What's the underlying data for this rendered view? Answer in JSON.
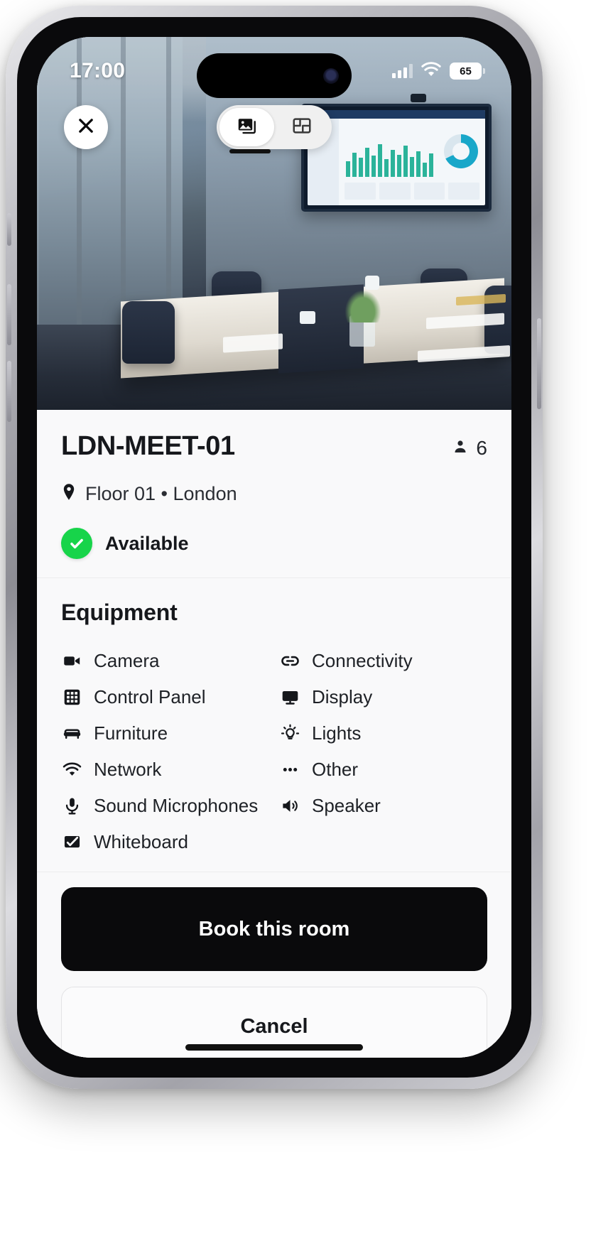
{
  "status_bar": {
    "time": "17:00",
    "battery_percent": "65",
    "signal_icon": "cellular-signal-icon",
    "wifi_icon": "wifi-icon"
  },
  "overlay": {
    "close_label": "×",
    "close_icon": "close-icon",
    "view_toggle": [
      {
        "id": "photo",
        "icon": "photos-icon",
        "active": true
      },
      {
        "id": "floorplan",
        "icon": "floorplan-icon",
        "active": false
      }
    ]
  },
  "room": {
    "name": "LDN-MEET-01",
    "capacity": "6",
    "capacity_icon": "person-icon",
    "location_icon": "map-pin-icon",
    "location": "Floor 01 • London",
    "status_icon": "check-circle-icon",
    "status": "Available",
    "status_color": "#17d44a"
  },
  "equipment": {
    "title": "Equipment",
    "items": [
      {
        "label": "Camera",
        "icon": "video-camera-icon"
      },
      {
        "label": "Connectivity",
        "icon": "link-icon"
      },
      {
        "label": "Control Panel",
        "icon": "grid-keypad-icon"
      },
      {
        "label": "Display",
        "icon": "monitor-icon"
      },
      {
        "label": "Furniture",
        "icon": "sofa-icon"
      },
      {
        "label": "Lights",
        "icon": "lightbulb-icon"
      },
      {
        "label": "Network",
        "icon": "wifi-icon"
      },
      {
        "label": "Other",
        "icon": "ellipsis-icon"
      },
      {
        "label": "Sound Microphones",
        "icon": "microphone-icon"
      },
      {
        "label": "Speaker",
        "icon": "speaker-icon"
      },
      {
        "label": "Whiteboard",
        "icon": "whiteboard-icon"
      }
    ]
  },
  "actions": {
    "primary_label": "Book this room",
    "secondary_label": "Cancel"
  }
}
